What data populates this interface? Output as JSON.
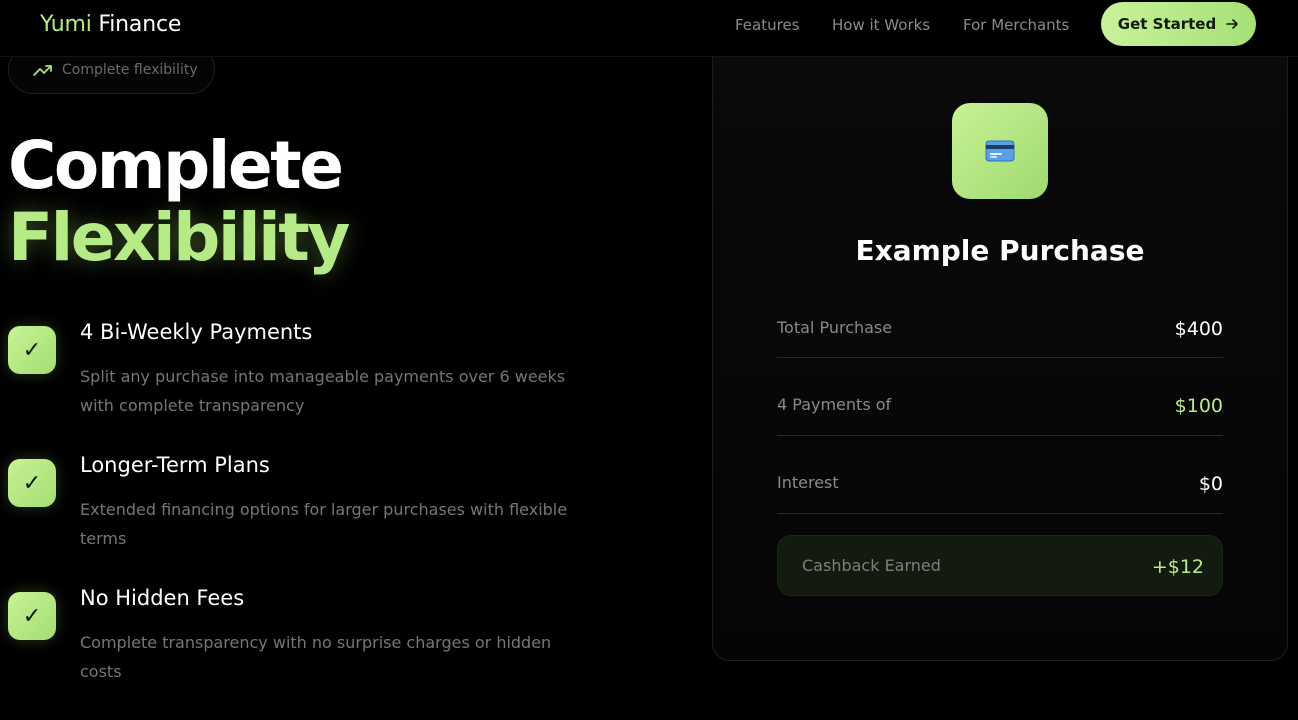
{
  "nav": {
    "logo_accent": "Yumi",
    "logo_main": "Finance",
    "links": [
      "Features",
      "How it Works",
      "For Merchants"
    ],
    "cta_label": "Get Started",
    "cta_icon": "arrow-right-icon"
  },
  "badge": {
    "label": "Complete flexibility",
    "icon": "trending-up-icon"
  },
  "headline": {
    "line1": "Complete",
    "line2": "Flexibility"
  },
  "features": [
    {
      "check": "✓",
      "title": "4 Bi-Weekly Payments",
      "desc": "Split any purchase into manageable payments over 6 weeks with complete transparency"
    },
    {
      "check": "✓",
      "title": "Longer-Term Plans",
      "desc": "Extended financing options for larger purchases with flexible terms"
    },
    {
      "check": "✓",
      "title": "No Hidden Fees",
      "desc": "Complete transparency with no surprise charges or hidden costs"
    }
  ],
  "card": {
    "icon": "credit-card-icon",
    "title": "Example Purchase",
    "rows": [
      {
        "label": "Total Purchase",
        "value": "$400"
      },
      {
        "label": "4 Payments of",
        "value": "$100"
      },
      {
        "label": "Interest",
        "value": "$0"
      }
    ],
    "cashback": {
      "label": "Cashback Earned",
      "value": "+$12"
    }
  },
  "colors": {
    "accent": "#b6ea86",
    "background": "#000000"
  }
}
